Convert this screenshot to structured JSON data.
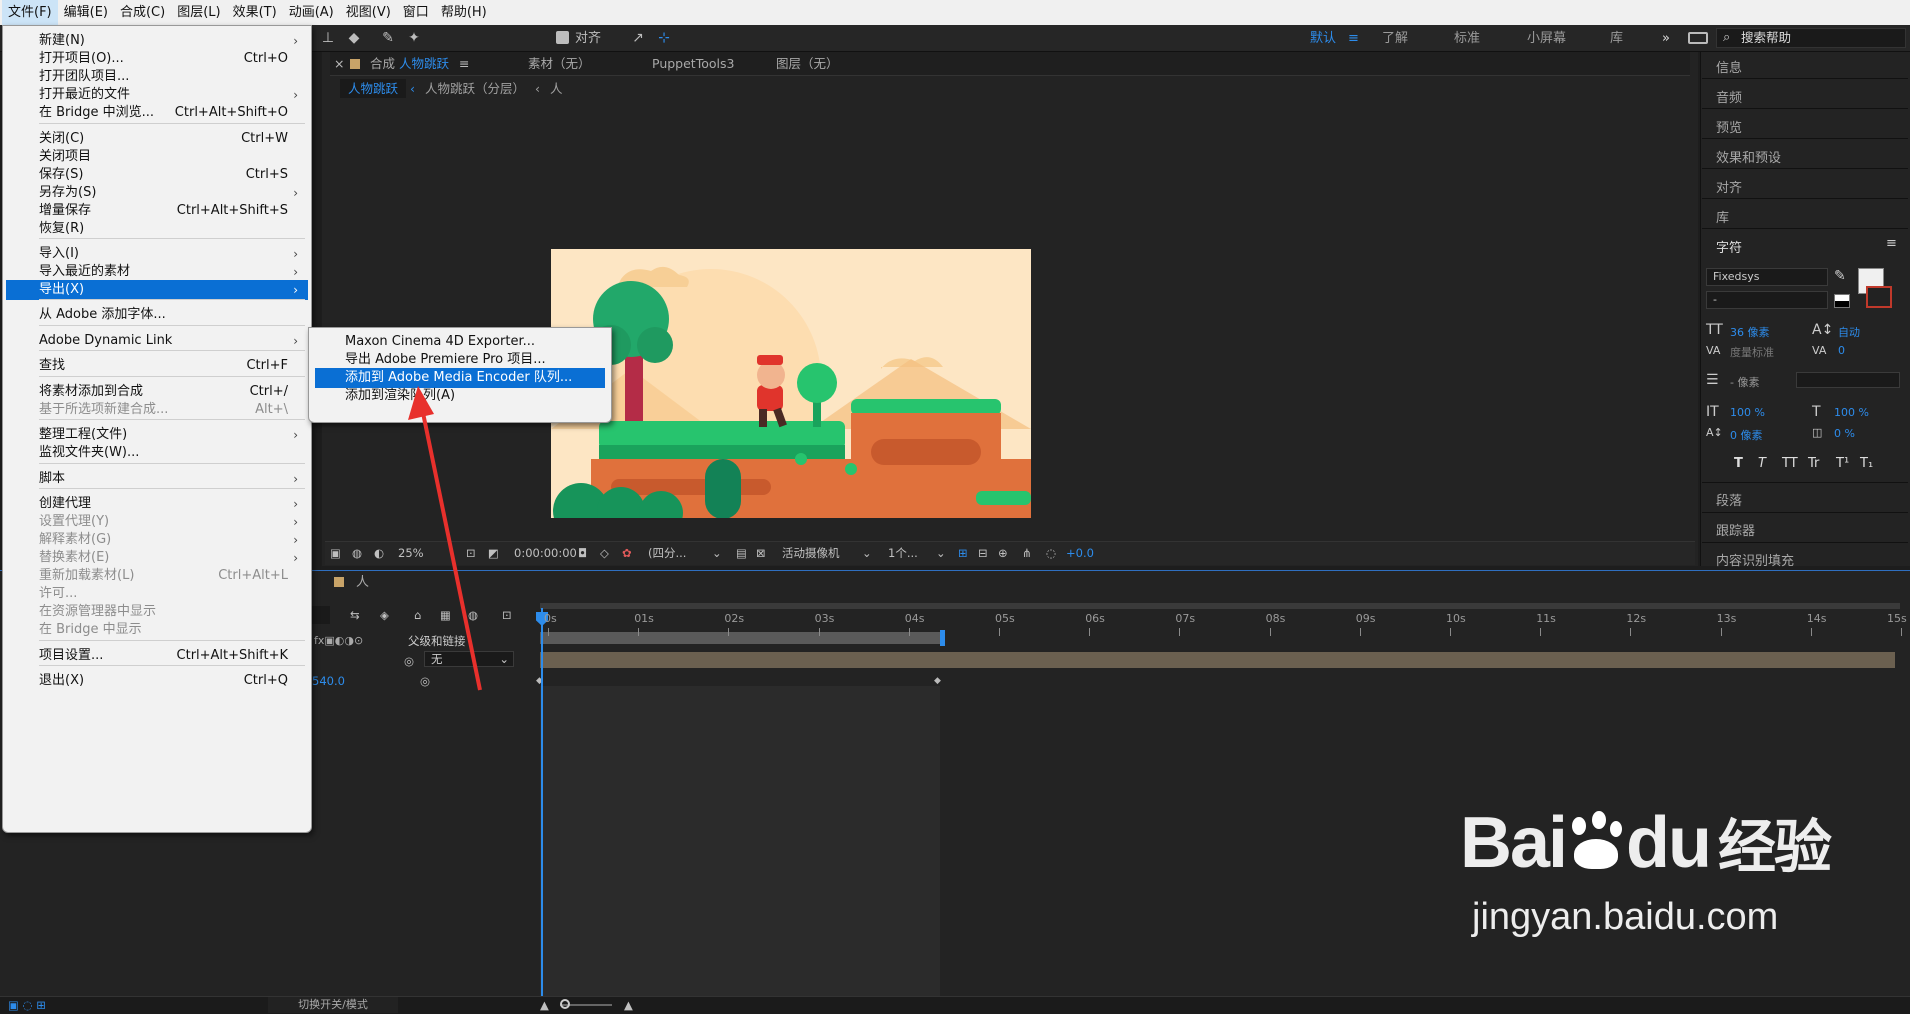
{
  "menubar": {
    "items": [
      "文件(F)",
      "编辑(E)",
      "合成(C)",
      "图层(L)",
      "效果(T)",
      "动画(A)",
      "视图(V)",
      "窗口",
      "帮助(H)"
    ]
  },
  "toolbar": {
    "align_label": "对齐",
    "workspaces": [
      "默认",
      "了解",
      "标准",
      "小屏幕",
      "库"
    ],
    "search_placeholder": "搜索帮助"
  },
  "file_menu": {
    "items": [
      {
        "label": "新建(N)",
        "shortcut": "",
        "submenu": true,
        "disabled": false
      },
      {
        "label": "打开项目(O)...",
        "shortcut": "Ctrl+O",
        "submenu": false,
        "disabled": false
      },
      {
        "label": "打开团队项目...",
        "shortcut": "",
        "submenu": false,
        "disabled": false
      },
      {
        "label": "打开最近的文件",
        "shortcut": "",
        "submenu": true,
        "disabled": false
      },
      {
        "label": "在 Bridge 中浏览...",
        "shortcut": "Ctrl+Alt+Shift+O",
        "submenu": false,
        "disabled": false
      },
      {
        "label": "关闭(C)",
        "shortcut": "Ctrl+W",
        "submenu": false,
        "disabled": false
      },
      {
        "label": "关闭项目",
        "shortcut": "",
        "submenu": false,
        "disabled": false
      },
      {
        "label": "保存(S)",
        "shortcut": "Ctrl+S",
        "submenu": false,
        "disabled": false
      },
      {
        "label": "另存为(S)",
        "shortcut": "",
        "submenu": true,
        "disabled": false
      },
      {
        "label": "增量保存",
        "shortcut": "Ctrl+Alt+Shift+S",
        "submenu": false,
        "disabled": false
      },
      {
        "label": "恢复(R)",
        "shortcut": "",
        "submenu": false,
        "disabled": false
      },
      {
        "label": "导入(I)",
        "shortcut": "",
        "submenu": true,
        "disabled": false
      },
      {
        "label": "导入最近的素材",
        "shortcut": "",
        "submenu": true,
        "disabled": false
      },
      {
        "label": "导出(X)",
        "shortcut": "",
        "submenu": true,
        "disabled": false,
        "highlighted": true
      },
      {
        "label": "从 Adobe 添加字体...",
        "shortcut": "",
        "submenu": false,
        "disabled": false
      },
      {
        "label": "Adobe Dynamic Link",
        "shortcut": "",
        "submenu": true,
        "disabled": false
      },
      {
        "label": "查找",
        "shortcut": "Ctrl+F",
        "submenu": false,
        "disabled": false
      },
      {
        "label": "将素材添加到合成",
        "shortcut": "Ctrl+/",
        "submenu": false,
        "disabled": false
      },
      {
        "label": "基于所选项新建合成...",
        "shortcut": "Alt+\\",
        "submenu": false,
        "disabled": true
      },
      {
        "label": "整理工程(文件)",
        "shortcut": "",
        "submenu": true,
        "disabled": false
      },
      {
        "label": "监视文件夹(W)...",
        "shortcut": "",
        "submenu": false,
        "disabled": false
      },
      {
        "label": "脚本",
        "shortcut": "",
        "submenu": true,
        "disabled": false
      },
      {
        "label": "创建代理",
        "shortcut": "",
        "submenu": true,
        "disabled": false
      },
      {
        "label": "设置代理(Y)",
        "shortcut": "",
        "submenu": true,
        "disabled": true
      },
      {
        "label": "解释素材(G)",
        "shortcut": "",
        "submenu": true,
        "disabled": true
      },
      {
        "label": "替换素材(E)",
        "shortcut": "",
        "submenu": true,
        "disabled": true
      },
      {
        "label": "重新加载素材(L)",
        "shortcut": "Ctrl+Alt+L",
        "submenu": false,
        "disabled": true
      },
      {
        "label": "许可...",
        "shortcut": "",
        "submenu": false,
        "disabled": true
      },
      {
        "label": "在资源管理器中显示",
        "shortcut": "",
        "submenu": false,
        "disabled": true
      },
      {
        "label": "在 Bridge 中显示",
        "shortcut": "",
        "submenu": false,
        "disabled": true
      },
      {
        "label": "项目设置...",
        "shortcut": "Ctrl+Alt+Shift+K",
        "submenu": false,
        "disabled": false
      },
      {
        "label": "退出(X)",
        "shortcut": "Ctrl+Q",
        "submenu": false,
        "disabled": false
      }
    ]
  },
  "export_submenu": {
    "items": [
      {
        "label": "Maxon Cinema 4D Exporter...",
        "highlighted": false
      },
      {
        "label": "导出 Adobe Premiere Pro 项目...",
        "highlighted": false
      },
      {
        "label": "添加到 Adobe Media Encoder 队列...",
        "highlighted": true
      },
      {
        "label": "添加到渲染队列(A)",
        "highlighted": false
      }
    ]
  },
  "comp_panel": {
    "tab_prefix": "合成",
    "comp_name": "人物跳跃",
    "footage_tab": "素材（无）",
    "puppet_tab": "PuppetTools3",
    "layer_tab": "图层（无）",
    "breadcrumbs": [
      "人物跳跃",
      "人物跳跃（分层）",
      "人"
    ],
    "viewer": {
      "zoom": "25%",
      "timecode": "0:00:00:00",
      "resolution": "(四分...",
      "camera": "活动摄像机",
      "views": "1个...",
      "exposure": "+0.0"
    }
  },
  "right_panel": {
    "sections": [
      "信息",
      "音频",
      "预览",
      "效果和预设",
      "对齐",
      "库",
      "字符",
      "段落",
      "跟踪器",
      "内容识别填充"
    ],
    "character": {
      "font": "Fixedsys",
      "style": "-",
      "size": "36 像素",
      "leading": "自动",
      "kerning": "度量标准",
      "tracking": "0",
      "stroke": "- 像素",
      "vscale": "100 %",
      "hscale": "100 %",
      "baseline": "0 像素",
      "tsume": "0 %",
      "styles": [
        "T",
        "T",
        "TT",
        "Tr",
        "T¹",
        "T₁"
      ]
    }
  },
  "timeline": {
    "tab": "人",
    "parent_label": "父级和链接",
    "parent_value": "无",
    "value_readout": "540.0",
    "ticks": [
      "0s",
      "01s",
      "02s",
      "03s",
      "04s",
      "05s",
      "06s",
      "07s",
      "08s",
      "09s",
      "10s",
      "11s",
      "12s",
      "13s",
      "14s",
      "15s"
    ],
    "footer": "切换开关/模式"
  },
  "watermark": {
    "brand": "Bai",
    "brand_du": "du",
    "brand_cn": "经验",
    "url": "jingyan.baidu.com"
  },
  "colors": {
    "accent": "#0a6fd4",
    "annotation": "#e8302c",
    "menu_bg": "#f2f2f2"
  }
}
